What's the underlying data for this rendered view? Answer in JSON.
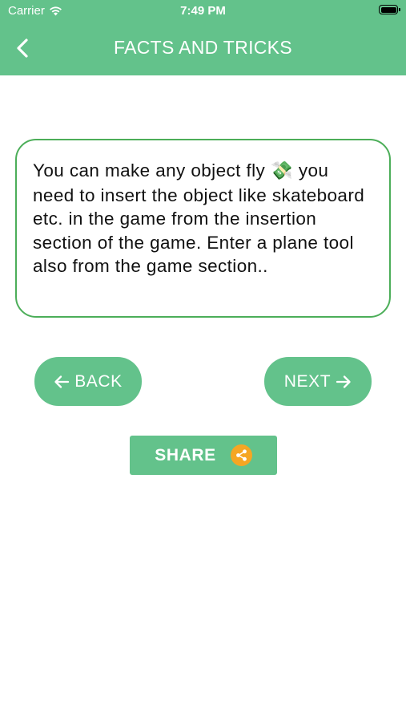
{
  "status_bar": {
    "carrier": "Carrier",
    "time": "7:49 PM"
  },
  "header": {
    "title": "FACTS AND TRICKS",
    "back_icon": "chevron-left-icon",
    "background": "#63c28b"
  },
  "fact": {
    "text_before_emoji": "You can make any object fly ",
    "emoji": "💸",
    "text_after_emoji": " you need to insert the object like skateboard etc. in the game from the insertion section of the game. Enter a plane tool also from the game section..",
    "border_color": "#4cae59"
  },
  "navigation": {
    "back_label": "BACK",
    "back_icon": "arrow-left-icon",
    "next_label": "NEXT",
    "next_icon": "arrow-right-icon"
  },
  "share": {
    "label": "SHARE",
    "icon": "share-icon",
    "icon_color": "#f5a623"
  }
}
